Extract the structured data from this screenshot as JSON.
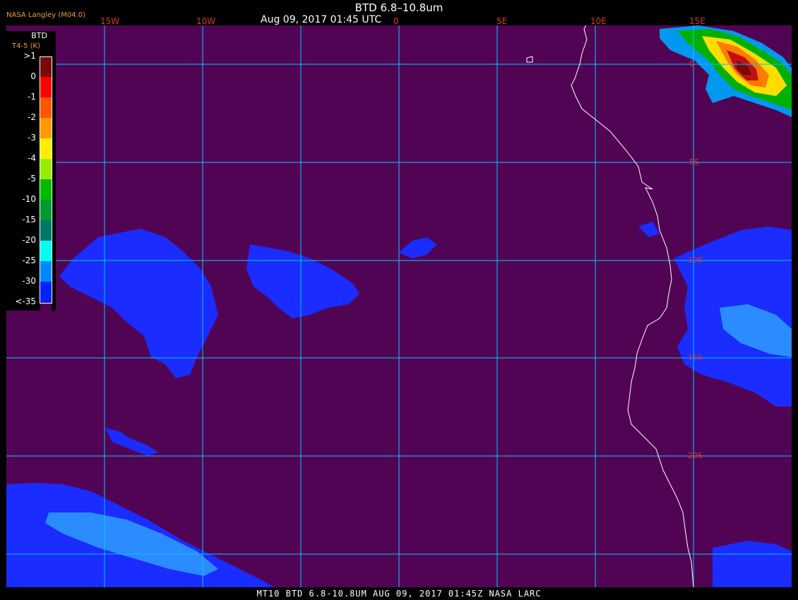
{
  "header": {
    "title": "BTD 6.8–10.8um",
    "subtitle": "Aug 09, 2017 01:45 UTC",
    "producer": "NASA Langley (M04.0)"
  },
  "footer": {
    "text": "MT10  BTD 6.8-10.8UM  AUG 09, 2017 01:45Z  NASA LARC"
  },
  "longitude_labels": [
    "15W",
    "10W",
    "0",
    "5E",
    "10E",
    "15E"
  ],
  "latitude_labels": [
    "0",
    "5S",
    "10S",
    "15S",
    "20S"
  ],
  "legend": {
    "title": "BTD",
    "subtitle": "T4-5 (K)",
    "entries": [
      {
        "label": ">1",
        "color": "#7a0a0a"
      },
      {
        "label": "0",
        "color": "#ff0000"
      },
      {
        "label": "-1",
        "color": "#ff5500"
      },
      {
        "label": "-2",
        "color": "#ff9900"
      },
      {
        "label": "-3",
        "color": "#ffee00"
      },
      {
        "label": "-4",
        "color": "#99ee00"
      },
      {
        "label": "-5",
        "color": "#00bb00"
      },
      {
        "label": "-10",
        "color": "#009933"
      },
      {
        "label": "-15",
        "color": "#007766"
      },
      {
        "label": "-20",
        "color": "#00ffee"
      },
      {
        "label": "-25",
        "color": "#0088ff"
      },
      {
        "label": "-30",
        "color": "#0022ff"
      },
      {
        "label": "<-35",
        "color": "#520454"
      }
    ]
  },
  "colors": {
    "background": "#520454",
    "grid": "#00c8ff",
    "coastline": "#ffffff",
    "low_cloud": "#1030ff",
    "mid_cloud": "#2090ff"
  }
}
